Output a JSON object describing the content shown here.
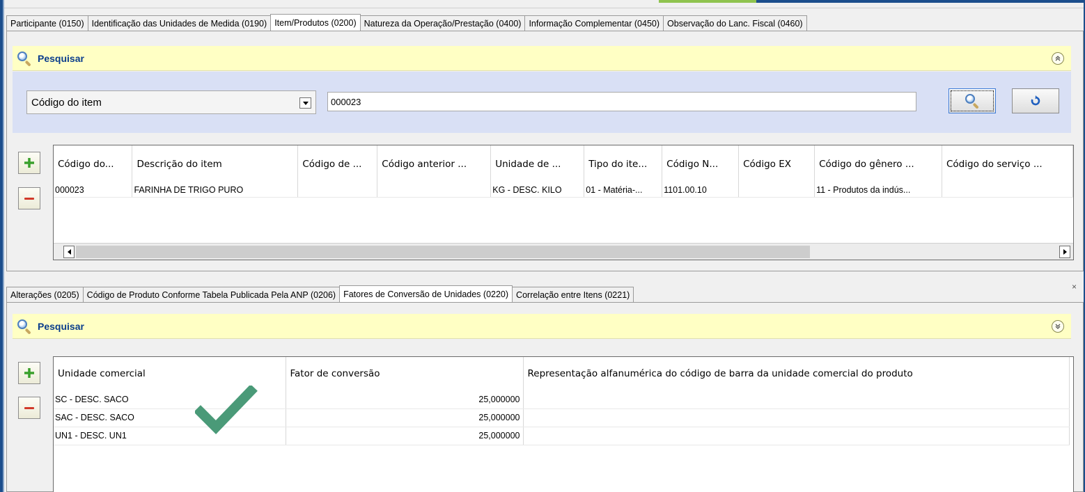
{
  "top_tabs": [
    {
      "label": "Participante (0150)"
    },
    {
      "label": "Identificação das Unidades de Medida (0190)"
    },
    {
      "label": "Item/Produtos (0200)",
      "active": true
    },
    {
      "label": "Natureza da Operação/Prestação (0400)"
    },
    {
      "label": "Informação Complementar (0450)"
    },
    {
      "label": "Observação do Lanc. Fiscal (0460)"
    }
  ],
  "search_top": {
    "title": "Pesquisar",
    "field_selected": "Código do item",
    "value": "000023",
    "collapse_icon": "double-chevron-up-icon"
  },
  "items_grid": {
    "columns": [
      "Código do...",
      "Descrição do item",
      "Código de ...",
      "Código anterior ...",
      "Unidade de ...",
      "Tipo do ite...",
      "Código N...",
      "Código EX",
      "Código do gênero ...",
      "Código do serviço ..."
    ],
    "rows": [
      [
        "000023",
        "FARINHA DE TRIGO PURO",
        "",
        "",
        "KG - DESC. KILO",
        "01 - Matéria-...",
        "1101.00.10",
        "",
        "11 - Produtos da indús...",
        ""
      ]
    ]
  },
  "bottom_tabs": [
    {
      "label": "Alterações (0205)"
    },
    {
      "label": "Código de Produto Conforme Tabela Publicada Pela ANP (0206)"
    },
    {
      "label": "Fatores de Conversão de Unidades (0220)",
      "active": true
    },
    {
      "label": "Correlação entre Itens (0221)"
    }
  ],
  "close_label": "×",
  "search_bottom": {
    "title": "Pesquisar",
    "collapse_icon": "double-chevron-down-icon"
  },
  "conversion_grid": {
    "columns": [
      "Unidade comercial",
      "Fator de conversão",
      "Representação alfanumérica do código de barra da unidade comercial do produto"
    ],
    "rows": [
      [
        "SC - DESC. SACO",
        "25,000000",
        ""
      ],
      [
        "SAC - DESC. SACO",
        "25,000000",
        ""
      ],
      [
        "UN1 - DESC. UN1",
        "25,000000",
        ""
      ]
    ]
  },
  "colors": {
    "search_bar": "#ffffc4",
    "filter_area": "#d9e0f5",
    "title_blue": "#0a3d8c",
    "check_green": "#4a9a78"
  }
}
